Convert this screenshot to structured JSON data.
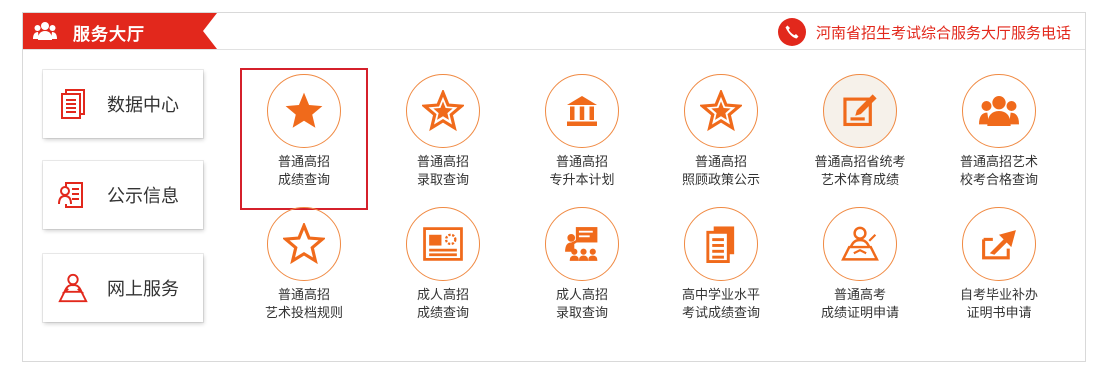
{
  "header": {
    "title": "服务大厅",
    "hotline_text": "河南省招生考试综合服务大厅服务电话"
  },
  "sidebar": {
    "items": [
      {
        "label": "数据中心",
        "icon": "document-stack-icon"
      },
      {
        "label": "公示信息",
        "icon": "notice-person-icon"
      },
      {
        "label": "网上服务",
        "icon": "online-person-icon"
      }
    ]
  },
  "services": {
    "row1": [
      {
        "line1": "普通高招",
        "line2": "成绩查询",
        "icon": "star-filled-icon"
      },
      {
        "line1": "普通高招",
        "line2": "录取查询",
        "icon": "star-outline-icon"
      },
      {
        "line1": "普通高招",
        "line2": "专升本计划",
        "icon": "bank-icon"
      },
      {
        "line1": "普通高招",
        "line2": "照顾政策公示",
        "icon": "star-outline-icon"
      },
      {
        "line1": "普通高招省统考",
        "line2": "艺术体育成绩",
        "icon": "edit-icon"
      },
      {
        "line1": "普通高招艺术",
        "line2": "校考合格查询",
        "icon": "group-icon"
      }
    ],
    "row2": [
      {
        "line1": "普通高招",
        "line2": "艺术投档规则",
        "icon": "star-outline-icon"
      },
      {
        "line1": "成人高招",
        "line2": "成绩查询",
        "icon": "certificate-icon"
      },
      {
        "line1": "成人高招",
        "line2": "录取查询",
        "icon": "presentation-icon"
      },
      {
        "line1": "高中学业水平",
        "line2": "考试成绩查询",
        "icon": "document-icon"
      },
      {
        "line1": "普通高考",
        "line2": "成绩证明申请",
        "icon": "person-desk-icon"
      },
      {
        "line1": "自考毕业补办",
        "line2": "证明书申请",
        "icon": "arrow-out-icon"
      }
    ]
  },
  "colors": {
    "brand_red": "#e2281c",
    "icon_orange": "#f06a1b",
    "selection_border": "#d5202b"
  }
}
